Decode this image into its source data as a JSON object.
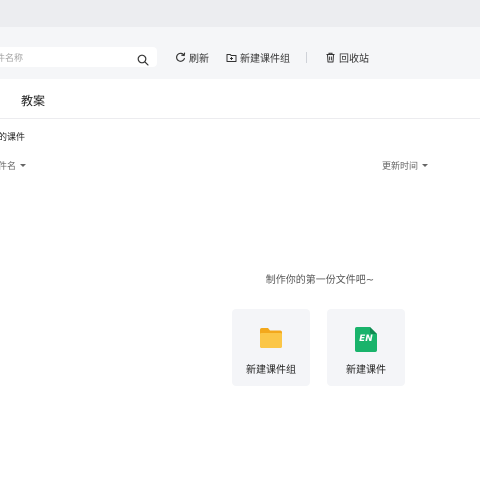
{
  "toolbar": {
    "search_placeholder": "件名称",
    "refresh_label": "刷新",
    "new_group_label": "新建课件组",
    "recycle_label": "回收站"
  },
  "tabs": [
    {
      "label": "教案"
    }
  ],
  "section": {
    "title": "的课件"
  },
  "sort": {
    "name_label": "件名",
    "time_label": "更新时间"
  },
  "empty": {
    "message": "制作你的第一份文件吧~"
  },
  "cards": [
    {
      "label": "新建课件组",
      "icon": "folder-icon"
    },
    {
      "label": "新建课件",
      "icon": "en-courseware-icon",
      "icon_text": "EN"
    }
  ],
  "colors": {
    "folder": "#f7b42c",
    "en_icon": "#19b36b"
  }
}
